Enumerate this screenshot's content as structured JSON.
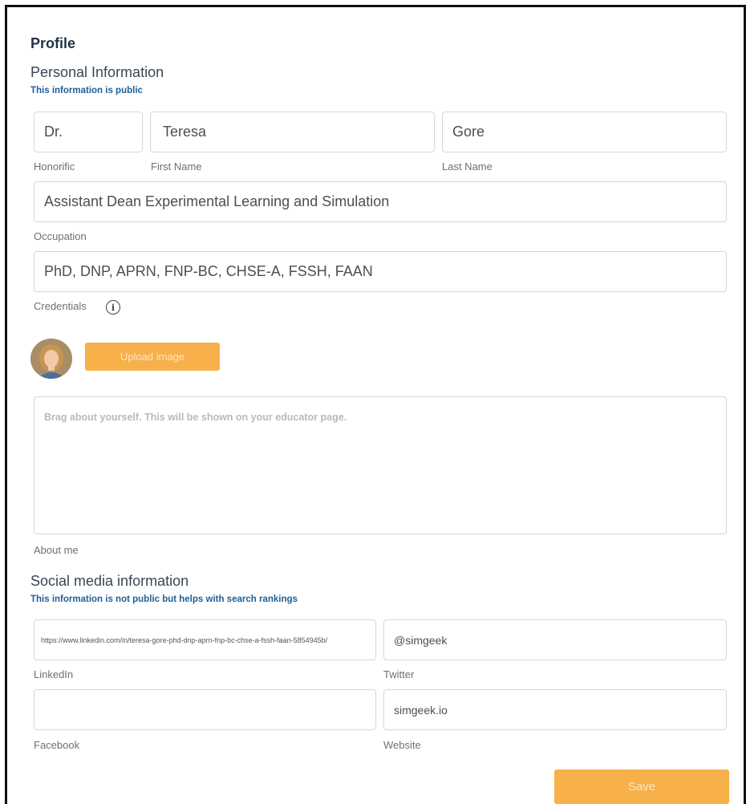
{
  "page": {
    "title": "Profile"
  },
  "personal": {
    "heading": "Personal Information",
    "subheading": "This information is public",
    "honorific": {
      "value": "Dr.",
      "label": "Honorific"
    },
    "first_name": {
      "value": "Teresa",
      "label": "First Name"
    },
    "last_name": {
      "value": "Gore",
      "label": "Last Name"
    },
    "occupation": {
      "value": "Assistant Dean Experimental Learning and Simulation",
      "label": "Occupation"
    },
    "credentials": {
      "value": "PhD, DNP, APRN, FNP-BC, CHSE-A, FSSH, FAAN",
      "label": "Credentials",
      "info_icon": "info-icon",
      "info_glyph": "i"
    },
    "upload_button": "Upload image",
    "about": {
      "placeholder": "Brag about yourself. This will be shown on your educator page.",
      "label": "About me"
    }
  },
  "social": {
    "heading": "Social media information",
    "subheading": "This information is not public but helps with search rankings",
    "linkedin": {
      "value": "https://www.linkedin.com/in/teresa-gore-phd-dnp-aprn-fnp-bc-chse-a-fssh-faan-5854945b/",
      "label": "LinkedIn"
    },
    "twitter": {
      "value": "@simgeek",
      "label": "Twitter"
    },
    "facebook": {
      "value": "",
      "label": "Facebook"
    },
    "website": {
      "value": "simgeek.io",
      "label": "Website"
    }
  },
  "actions": {
    "save_label": "Save"
  },
  "colors": {
    "accent": "#f7b04a",
    "link_blue": "#1f5f96",
    "border": "#d3d6dc"
  }
}
